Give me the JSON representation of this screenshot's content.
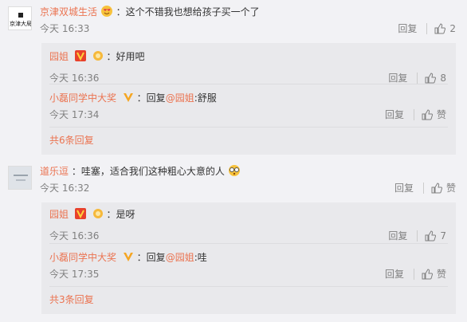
{
  "colors": {
    "accent": "#eb7350",
    "meta": "#808080",
    "background": "#f2f2f5",
    "reply_background": "#e9e9ec"
  },
  "comments": [
    {
      "username": "京津双城生活",
      "avatar_text": "京津大局",
      "emoji": "heart-eyes-emoji",
      "text": "：这个不错我也想给孩子买一个了",
      "time": "今天 16:33",
      "reply_label": "回复",
      "like_count": "2",
      "replies": [
        {
          "username": "园姐",
          "badges": [
            "v-badge",
            "fan-badge"
          ],
          "text": "：好用吧",
          "time": "今天 16:36",
          "reply_label": "回复",
          "like_count": "8"
        },
        {
          "username": "小磊同学中大奖",
          "badges": [
            "gold-v-badge"
          ],
          "text_prefix": "：回复",
          "mention": "@园姐",
          "text": ":舒服",
          "time": "今天 17:34",
          "reply_label": "回复",
          "like_count": "赞"
        }
      ],
      "more_label": "共6条回复"
    },
    {
      "username": "道乐逗",
      "avatar_text": "",
      "text": "：哇塞，适合我们这种粗心大意的人",
      "emoji": "dizzy-emoji",
      "time": "今天 16:32",
      "reply_label": "回复",
      "like_count": "赞",
      "replies": [
        {
          "username": "园姐",
          "badges": [
            "v-badge",
            "fan-badge"
          ],
          "text": "：是呀",
          "time": "今天 16:36",
          "reply_label": "回复",
          "like_count": "7"
        },
        {
          "username": "小磊同学中大奖",
          "badges": [
            "gold-v-badge"
          ],
          "text_prefix": "：回复",
          "mention": "@园姐",
          "text": ":哇",
          "time": "今天 17:35",
          "reply_label": "回复",
          "like_count": "赞"
        }
      ],
      "more_label": "共3条回复"
    }
  ]
}
